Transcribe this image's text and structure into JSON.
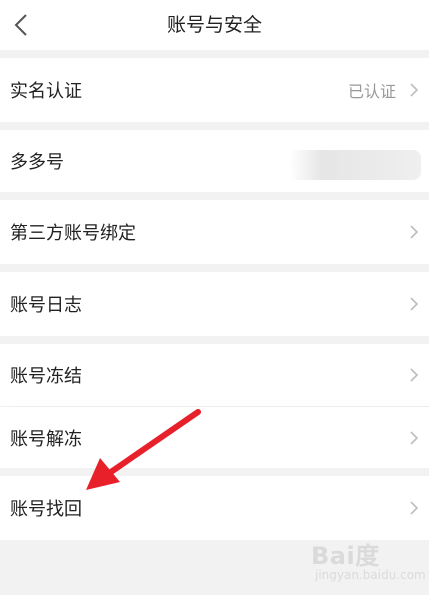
{
  "header": {
    "title": "账号与安全",
    "back_icon": "chevron-left-icon"
  },
  "items": [
    {
      "label": "实名认证",
      "value": "已认证"
    },
    {
      "label": "多多号"
    },
    {
      "label": "第三方账号绑定"
    },
    {
      "label": "账号日志"
    },
    {
      "label": "账号冻结"
    },
    {
      "label": "账号解冻"
    },
    {
      "label": "账号找回"
    }
  ],
  "annotation": {
    "arrow_color": "#e8202a"
  },
  "watermark": {
    "brand": "Bai度",
    "sub": "jingyan.baidu.com"
  }
}
